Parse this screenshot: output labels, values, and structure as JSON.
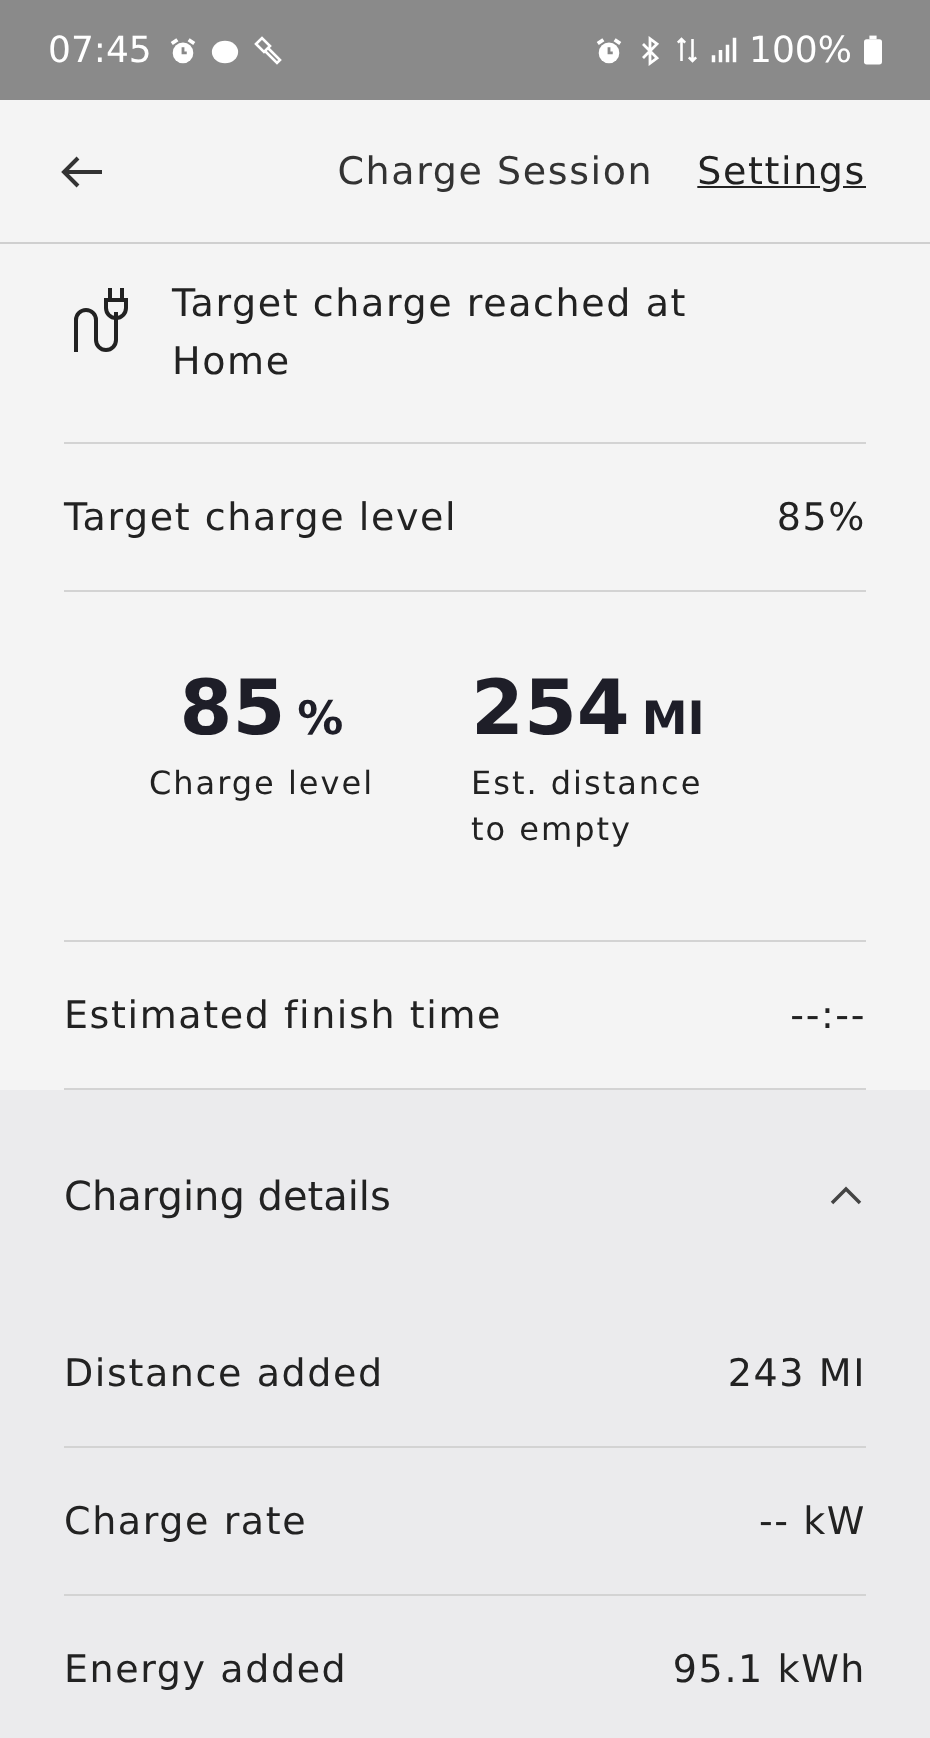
{
  "status_bar": {
    "time": "07:45",
    "battery": "100%"
  },
  "header": {
    "title": "Charge Session",
    "action": "Settings"
  },
  "notice": {
    "text": "Target charge reached at Home"
  },
  "target": {
    "label": "Target charge level",
    "value": "85%"
  },
  "stats": [
    {
      "value": "85",
      "unit": "%",
      "label": "Charge level"
    },
    {
      "value": "254",
      "unit": "MI",
      "label": "Est. distance to empty"
    }
  ],
  "finish": {
    "label": "Estimated finish time",
    "value": "--:--"
  },
  "details": {
    "title": "Charging details",
    "expanded": true,
    "rows": [
      {
        "label": "Distance added",
        "value": "243 MI"
      },
      {
        "label": "Charge rate",
        "value": "-- kW"
      },
      {
        "label": "Energy added",
        "value": "95.1 kWh"
      }
    ]
  }
}
